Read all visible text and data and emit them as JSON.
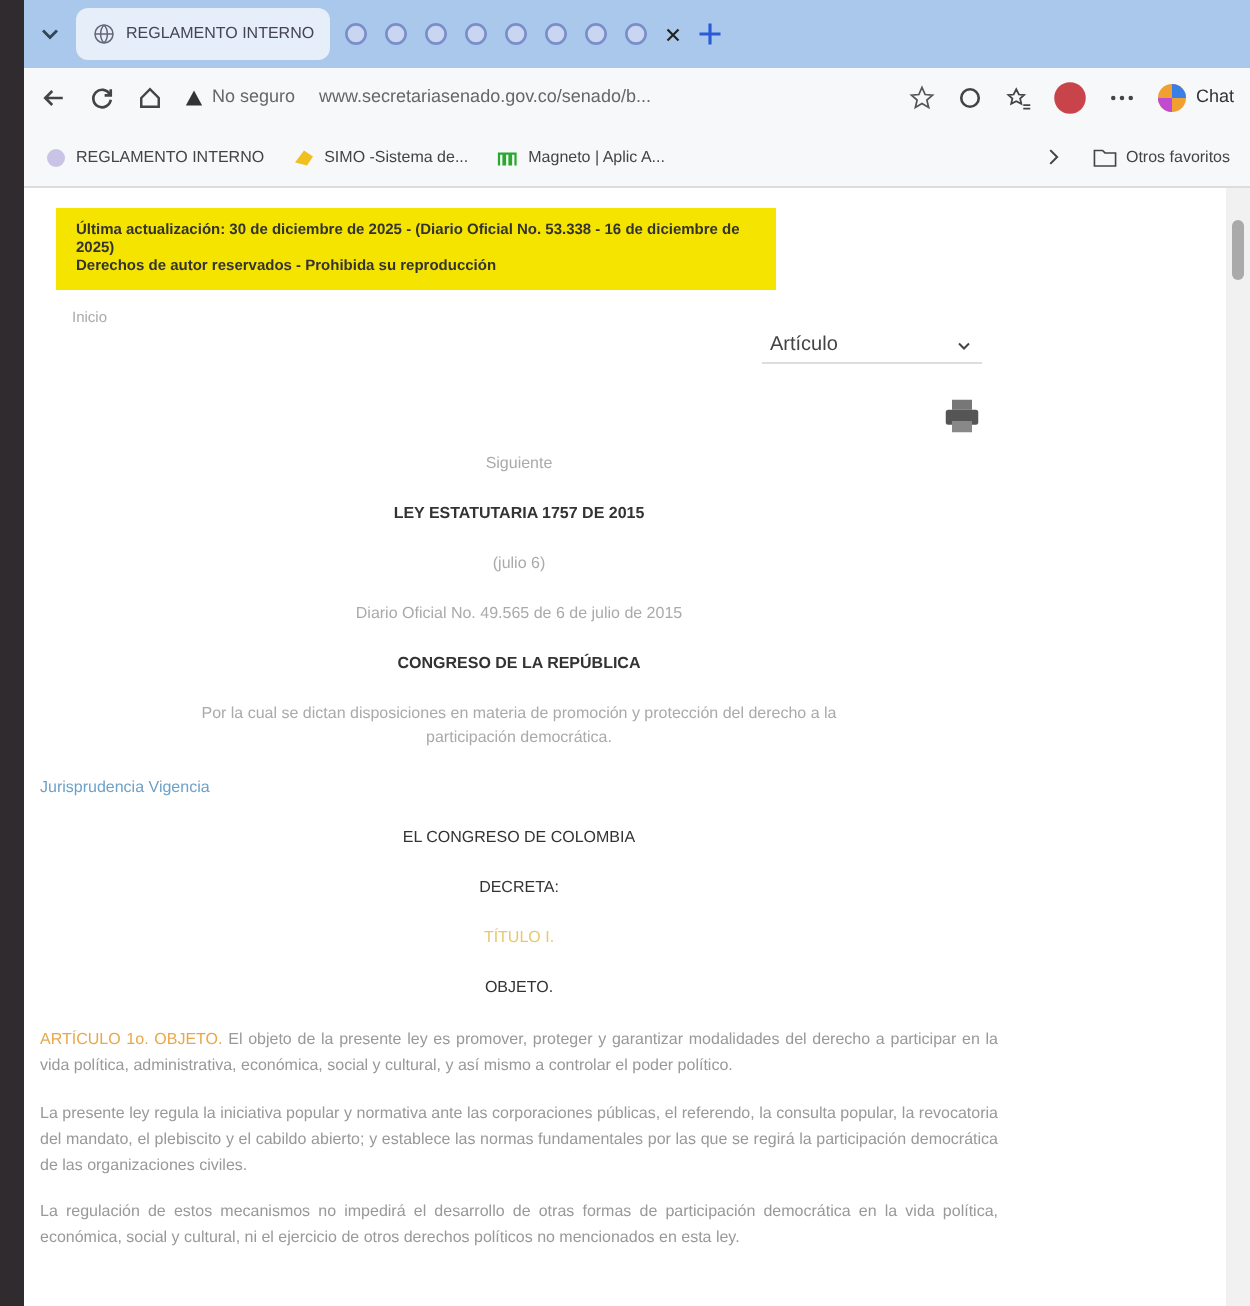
{
  "browser": {
    "tab_title": "REGLAMENTO INTERNO",
    "security": "No seguro",
    "url": "www.secretariasenado.gov.co/senado/b...",
    "chat": "Chat",
    "bookmarks": [
      "REGLAMENTO INTERNO",
      "SIMO -Sistema de...",
      "Magneto | Aplic A..."
    ],
    "other_bookmarks": "Otros favoritos"
  },
  "notice": [
    "Última actualización: 30 de diciembre de 2025 - (Diario Oficial No. 53.338 - 16 de diciembre de 2025)",
    "Derechos de autor reservados - Prohibida su reproducción"
  ],
  "home_link": "Inicio",
  "jump_select": {
    "value": "Artículo"
  },
  "document": [
    {
      "kind": "nav",
      "text": "Siguiente"
    },
    {
      "kind": "heading",
      "text": "LEY ESTATUTARIA 1757 DE 2015"
    },
    {
      "kind": "faint",
      "text": "(julio 6)"
    },
    {
      "kind": "faint",
      "text": "Diario Oficial No. 49.565 de 6 de julio de 2015"
    },
    {
      "kind": "heading",
      "text": "CONGRESO DE LA REPÚBLICA"
    },
    {
      "kind": "faint",
      "text": "Por la cual se dictan disposiciones en materia de promoción y protección del derecho a la participación democrática."
    },
    {
      "kind": "link",
      "text": "Jurisprudencia Vigencia"
    },
    {
      "kind": "plain",
      "text": "EL CONGRESO DE COLOMBIA"
    },
    {
      "kind": "plain",
      "text": "DECRETA:"
    },
    {
      "kind": "title",
      "text": "TÍTULO I."
    },
    {
      "kind": "plain",
      "text": "OBJETO."
    },
    {
      "kind": "article",
      "lead": "ARTÍCULO 1o. OBJETO.",
      "text": "El objeto de la presente ley es promover, proteger y garantizar modalidades del derecho a participar en la vida política, administrativa, económica, social y cultural, y así mismo a controlar el poder político."
    },
    {
      "kind": "paragraph",
      "text": "La presente ley regula la iniciativa popular y normativa ante las corporaciones públicas, el referendo, la consulta popular, la revocatoria del mandato, el plebiscito y el cabildo abierto; y establece las normas fundamentales por las que se regirá la participación democrática de las organizaciones civiles."
    },
    {
      "kind": "paragraph",
      "text": "La regulación de estos mecanismos no impedirá el desarrollo de otras formas de participación democrática en la vida política, económica, social y cultural, ni el ejercicio de otros derechos políticos no mencionados en esta ley."
    }
  ]
}
